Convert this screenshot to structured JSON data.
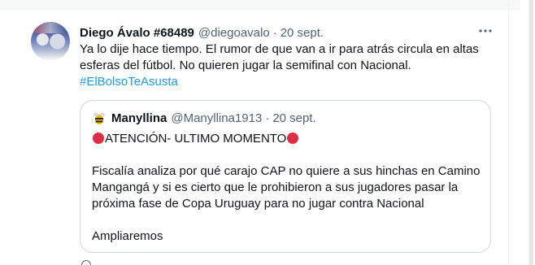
{
  "tweet": {
    "display_name": "Diego Ávalo #68489",
    "handle": "@diegoavalo",
    "separator": "·",
    "time": "20 sept.",
    "more_icon": "more-horizontal-icon",
    "text_lines": [
      "Ya lo dije hace tiempo. El rumor de que van a ir para atrás circula en altas",
      "esferas del fútbol. No quieren jugar la semifinal con Nacional."
    ],
    "hashtag": "#ElBolsoTeAsusta"
  },
  "quoted_tweet": {
    "display_name": "Manyllina",
    "handle": "@Manyllina1913",
    "separator": "·",
    "time": "20 sept.",
    "alert_text": "ATENCIÓN- ULTIMO MOMENTO",
    "body_lines": [
      "Fiscalía analiza por qué carajo CAP no quiere a sus hinchas en Camino",
      "Mangangá y si es cierto que le prohibieron a sus jugadores pasar la",
      "próxima fase de Copa Uruguay para no jugar contra Nacional"
    ],
    "closing": "Ampliaremos"
  },
  "colors": {
    "text": "#0f1419",
    "secondary": "#536471",
    "link": "#1d9bf0",
    "border": "#cfd9de",
    "red_circle": "#dd2e44"
  }
}
